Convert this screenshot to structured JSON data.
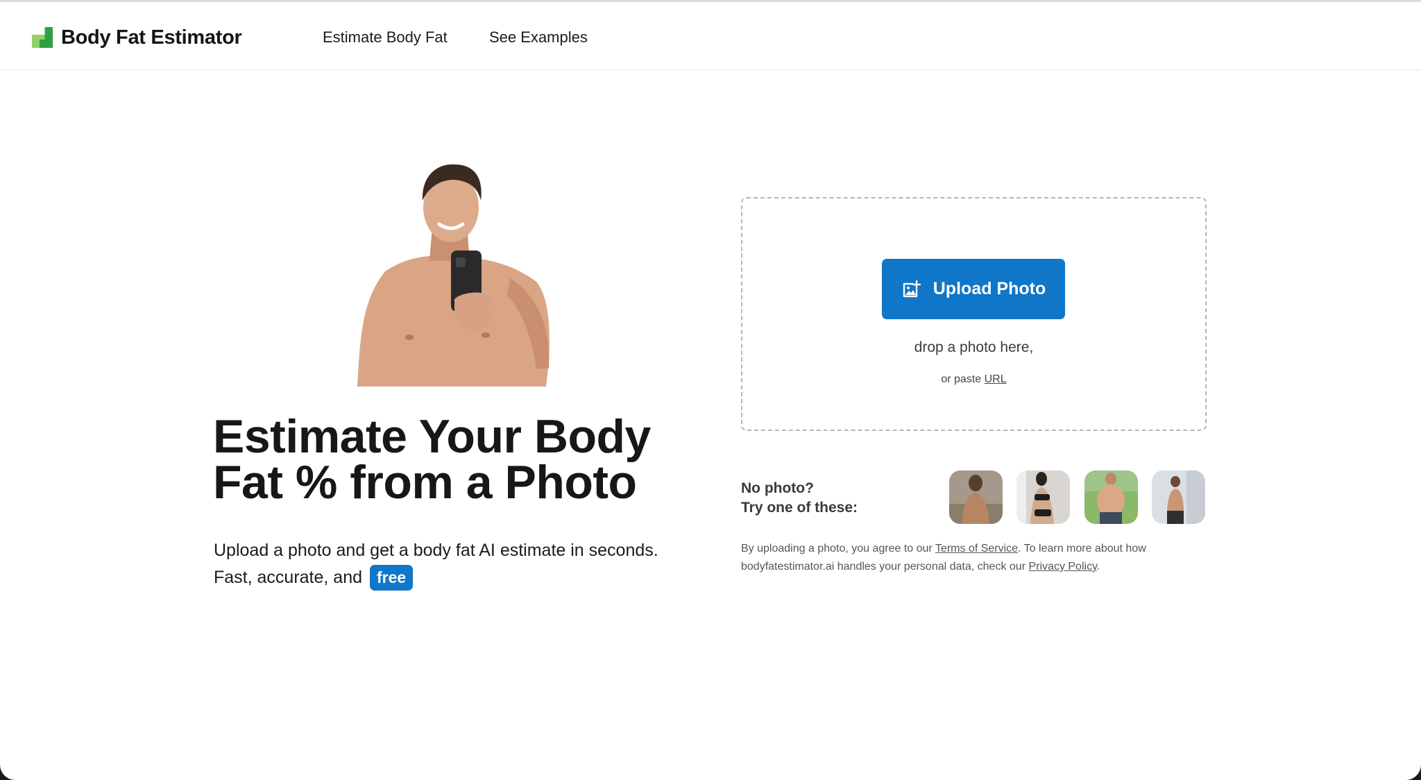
{
  "header": {
    "brand": "Body Fat Estimator",
    "nav": [
      {
        "label": "Estimate Body Fat"
      },
      {
        "label": "See Examples"
      }
    ]
  },
  "hero": {
    "title": "Estimate Your Body Fat % from a Photo",
    "subtitle_line1": "Upload a photo and get a body fat AI estimate in seconds.",
    "subtitle_line2": "Fast, accurate, and",
    "badge": "free"
  },
  "upload": {
    "button_label": "Upload Photo",
    "drop_text": "drop a photo here,",
    "paste_prefix": "or paste",
    "paste_link": "URL"
  },
  "examples": {
    "line1": "No photo?",
    "line2": "Try one of these:"
  },
  "legal": {
    "part1": "By uploading a photo, you agree to our",
    "tos_link": "Terms of Service",
    "part2": ". To learn more about how bodyfatestimator.ai handles your personal data, check our",
    "privacy_link": "Privacy Policy",
    "part3": "."
  },
  "colors": {
    "accent": "#0f76c8",
    "logo_light": "#8fd16a",
    "logo_dark": "#2ea043"
  }
}
